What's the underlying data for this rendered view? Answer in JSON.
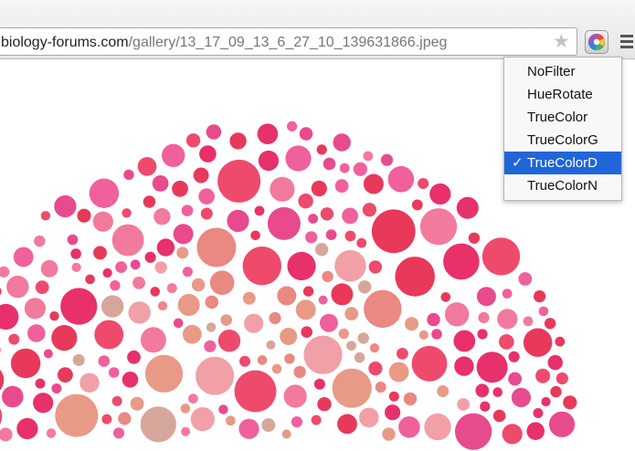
{
  "address_bar": {
    "host": "biology-forums.com",
    "path": "/gallery/13_17_09_13_6_27_10_139631866.jpeg"
  },
  "icons": {
    "bookmark": "star-icon",
    "extension": "color-filter-extension-icon",
    "menu": "hamburger-menu-icon"
  },
  "filter_menu": {
    "items": [
      {
        "label": "NoFilter",
        "selected": false
      },
      {
        "label": "HueRotate",
        "selected": false
      },
      {
        "label": "TrueColor",
        "selected": false
      },
      {
        "label": "TrueColorG",
        "selected": false
      },
      {
        "label": "TrueColorD",
        "selected": true
      },
      {
        "label": "TrueColorN",
        "selected": false
      }
    ],
    "check_mark": "✓"
  },
  "colors": {
    "dot_palette": [
      "#e8395a",
      "#ee4a6c",
      "#e84a8e",
      "#f0609c",
      "#e8306a",
      "#f27a9c",
      "#ea8882",
      "#e89a86",
      "#d7a69a",
      "#f1a0a8"
    ],
    "menu_highlight": "#2166d8"
  }
}
